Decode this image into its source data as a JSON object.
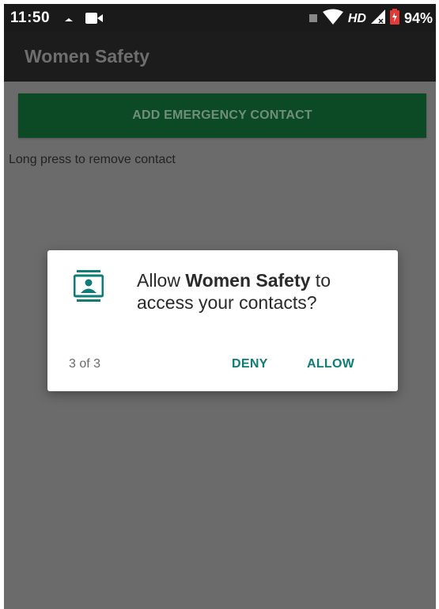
{
  "status_bar": {
    "time": "11:50",
    "hd_label": "HD",
    "battery_percent": "94%",
    "icons": [
      "cast-icon",
      "video-icon",
      "sim-icon",
      "wifi-icon",
      "signal-icon",
      "battery-icon"
    ]
  },
  "app_bar": {
    "title": "Women Safety"
  },
  "main": {
    "add_button_label": "ADD EMERGENCY CONTACT",
    "hint": "Long press to remove contact"
  },
  "dialog": {
    "message_prefix": "Allow ",
    "app_name": "Women Safety",
    "message_suffix": " to access your contacts?",
    "counter": "3 of 3",
    "deny_label": "DENY",
    "allow_label": "ALLOW",
    "icon": "contacts-icon"
  },
  "colors": {
    "accent": "#0d7d75",
    "button_bg": "#0c4a25",
    "scrim": "#6b6b6b",
    "status_bar_bg": "#1a1a1a"
  }
}
